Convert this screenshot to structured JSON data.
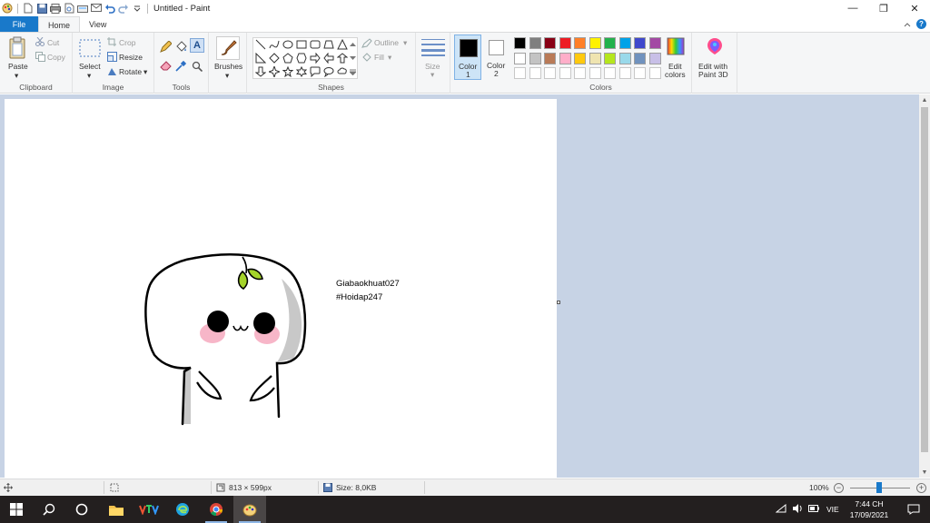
{
  "window": {
    "title": "Untitled - Paint",
    "minimize_glyph": "—",
    "restore_glyph": "❐",
    "close_glyph": "✕"
  },
  "tabs": {
    "file": "File",
    "home": "Home",
    "view": "View"
  },
  "ribbon": {
    "clipboard": {
      "label": "Clipboard",
      "paste": "Paste",
      "cut": "Cut",
      "copy": "Copy"
    },
    "image": {
      "label": "Image",
      "select": "Select",
      "crop": "Crop",
      "resize": "Resize",
      "rotate": "Rotate"
    },
    "tools": {
      "label": "Tools"
    },
    "brushes": {
      "label": "Brushes"
    },
    "shapes": {
      "label": "Shapes",
      "outline": "Outline",
      "fill": "Fill"
    },
    "size": {
      "label": "Size"
    },
    "color1": {
      "line1": "Color",
      "line2": "1",
      "value": "#000000"
    },
    "color2": {
      "line1": "Color",
      "line2": "2",
      "value": "#ffffff"
    },
    "colors": {
      "label": "Colors",
      "row1": [
        "#000000",
        "#7f7f7f",
        "#880015",
        "#ed1c24",
        "#ff7f27",
        "#fff200",
        "#22b14c",
        "#00a2e8",
        "#3f48cc",
        "#a349a4"
      ],
      "row2": [
        "#ffffff",
        "#c3c3c3",
        "#b97a57",
        "#ffaec9",
        "#ffc90e",
        "#efe4b0",
        "#b5e61d",
        "#99d9ea",
        "#7092be",
        "#c8bfe7"
      ],
      "edit_colors_line1": "Edit",
      "edit_colors_line2": "colors"
    },
    "paint3d": {
      "line1": "Edit with",
      "line2": "Paint 3D"
    }
  },
  "canvas": {
    "text_line1": "Giabaokhuat027",
    "text_line2": "#Hoidap247"
  },
  "statusbar": {
    "dimensions": "813 × 599px",
    "size": "Size: 8,0KB",
    "zoom": "100%",
    "zoom_level": 1.0
  },
  "taskbar": {
    "language": "VIE",
    "time": "7:44 CH",
    "date": "17/09/2021"
  },
  "colors": {
    "accent": "#1979ca",
    "canvas_bg": "#c7d3e5",
    "taskbar_bg": "#231f1f"
  }
}
